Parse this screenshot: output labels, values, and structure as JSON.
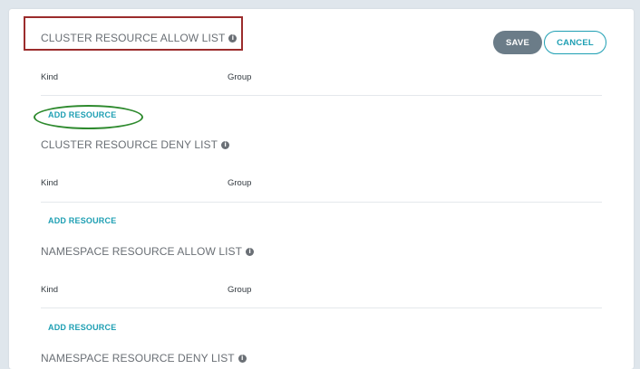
{
  "colors": {
    "accent": "#1e9fb3",
    "save_button_bg": "#6b7c88",
    "highlight_box": "#9b2c2c",
    "highlight_ellipse": "#2e8a2e"
  },
  "toolbar": {
    "save_label": "SAVE",
    "cancel_label": "CANCEL"
  },
  "sections": [
    {
      "title": "CLUSTER RESOURCE ALLOW LIST",
      "columns": [
        "Kind",
        "Group"
      ],
      "add_label": "ADD RESOURCE"
    },
    {
      "title": "CLUSTER RESOURCE DENY LIST",
      "columns": [
        "Kind",
        "Group"
      ],
      "add_label": "ADD RESOURCE"
    },
    {
      "title": "NAMESPACE RESOURCE ALLOW LIST",
      "columns": [
        "Kind",
        "Group"
      ],
      "add_label": "ADD RESOURCE"
    },
    {
      "title": "NAMESPACE RESOURCE DENY LIST"
    }
  ],
  "icons": {
    "info": "info-icon",
    "info_glyph": "i"
  }
}
